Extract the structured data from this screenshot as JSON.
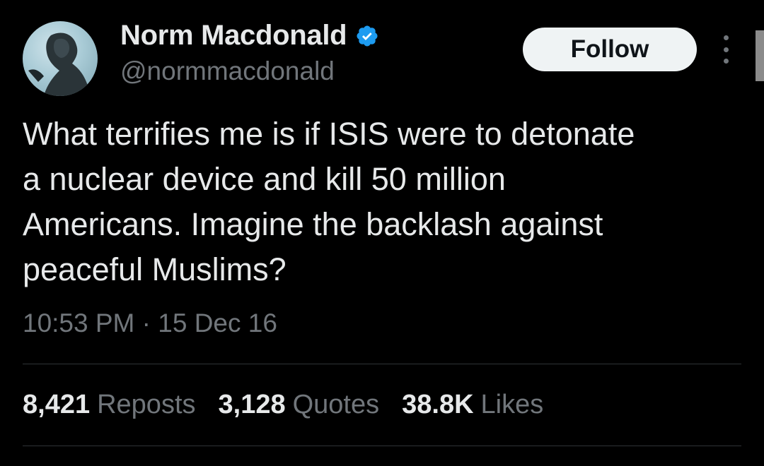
{
  "author": {
    "display_name": "Norm Macdonald",
    "handle": "@normmacdonald",
    "verified_icon": "verified-badge-icon",
    "verified_color": "#1d9bf0"
  },
  "actions": {
    "follow_label": "Follow",
    "more_icon": "more-options-icon"
  },
  "tweet": {
    "text": "What terrifies me is if ISIS were to detonate\na nuclear device and kill 50 million\nAmericans. Imagine the backlash against\npeaceful Muslims?",
    "time": "10:53 PM",
    "separator": "·",
    "date": "15 Dec 16"
  },
  "stats": {
    "reposts_count": "8,421",
    "reposts_label": "Reposts",
    "quotes_count": "3,128",
    "quotes_label": "Quotes",
    "likes_count": "38.8K",
    "likes_label": "Likes"
  },
  "colors": {
    "background": "#000000",
    "primary_text": "#e7e9ea",
    "secondary_text": "#71767b",
    "follow_bg": "#eff3f4",
    "divider": "#2f3336"
  }
}
